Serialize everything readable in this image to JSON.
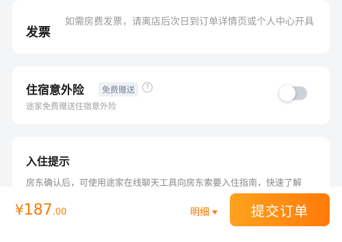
{
  "invoice": {
    "title": "发票",
    "description": "如需房费发票，请离店后次日到订单详情页或个人中心开具"
  },
  "insurance": {
    "title": "住宿意外险",
    "badge": "免费赠送",
    "help_icon": "question-circle",
    "subtitle": "途家免费赠送住宿意外险",
    "toggle_on": false
  },
  "checkin": {
    "title": "入住提示",
    "text": "房东确认后，可使用途家在线聊天工具向房东索要入住指南，快速了解"
  },
  "footer": {
    "currency": "¥",
    "price_int": "187",
    "price_dec": ".00",
    "detail_label": "明细",
    "submit_label": "提交订单",
    "accent_color": "#f77a00"
  }
}
